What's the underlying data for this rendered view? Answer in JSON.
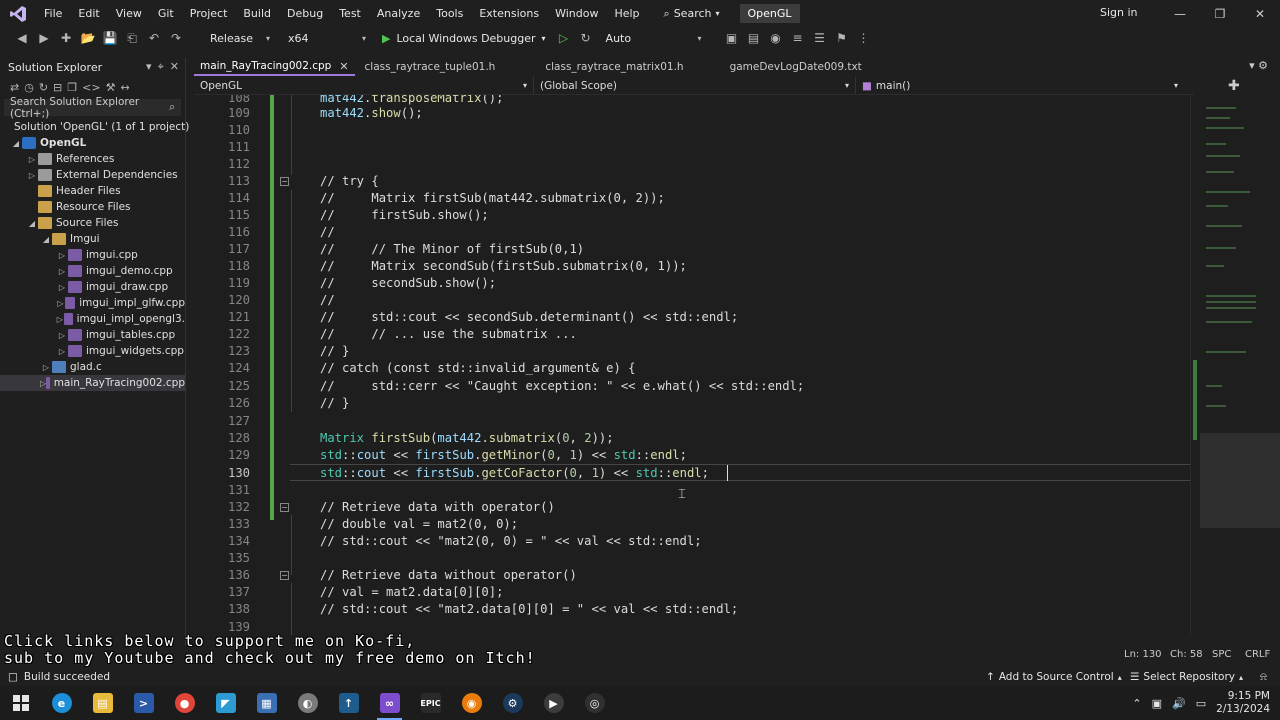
{
  "menubar": {
    "items": [
      "File",
      "Edit",
      "View",
      "Git",
      "Project",
      "Build",
      "Debug",
      "Test",
      "Analyze",
      "Tools",
      "Extensions",
      "Window",
      "Help"
    ],
    "search_label": "Search",
    "solution_name": "OpenGL",
    "sign_in": "Sign in"
  },
  "toolbar": {
    "configuration": "Release",
    "platform": "x64",
    "debugger": "Local Windows Debugger",
    "target": "Auto"
  },
  "solution_explorer": {
    "title": "Solution Explorer",
    "search_placeholder": "Search Solution Explorer (Ctrl+;)",
    "tree": [
      {
        "label": "Solution 'OpenGL' (1 of 1 project)",
        "icon": "solution-icon"
      },
      {
        "label": "OpenGL",
        "icon": "project-icon"
      },
      {
        "label": "References",
        "icon": "references-icon"
      },
      {
        "label": "External Dependencies",
        "icon": "external-deps-icon"
      },
      {
        "label": "Header Files",
        "icon": "folder-icon"
      },
      {
        "label": "Resource Files",
        "icon": "folder-icon"
      },
      {
        "label": "Source Files",
        "icon": "folder-icon"
      },
      {
        "label": "Imgui",
        "icon": "folder-icon"
      },
      {
        "label": "imgui.cpp",
        "icon": "cpp-file-icon"
      },
      {
        "label": "imgui_demo.cpp",
        "icon": "cpp-file-icon"
      },
      {
        "label": "imgui_draw.cpp",
        "icon": "cpp-file-icon"
      },
      {
        "label": "imgui_impl_glfw.cpp",
        "icon": "cpp-file-icon"
      },
      {
        "label": "imgui_impl_opengl3.",
        "icon": "cpp-file-icon"
      },
      {
        "label": "imgui_tables.cpp",
        "icon": "cpp-file-icon"
      },
      {
        "label": "imgui_widgets.cpp",
        "icon": "cpp-file-icon"
      },
      {
        "label": "glad.c",
        "icon": "c-file-icon"
      },
      {
        "label": "main_RayTracing002.cpp",
        "icon": "cpp-file-icon"
      }
    ]
  },
  "tabs": [
    {
      "label": "main_RayTracing002.cpp",
      "active": true
    },
    {
      "label": "class_raytrace_tuple01.h",
      "active": false
    },
    {
      "label": "class_raytrace_matrix01.h",
      "active": false
    },
    {
      "label": "gameDevLogDate009.txt",
      "active": false
    }
  ],
  "navbar": {
    "project": "OpenGL",
    "scope": "(Global Scope)",
    "member": "main()"
  },
  "code": {
    "current_line": "130",
    "lines": [
      {
        "n": "108",
        "text": "mat442.transposeMatrix();"
      },
      {
        "n": "109",
        "text": "mat442.show();"
      },
      {
        "n": "110",
        "text": ""
      },
      {
        "n": "111",
        "text": ""
      },
      {
        "n": "112",
        "text": ""
      },
      {
        "n": "113",
        "text": "// try {"
      },
      {
        "n": "114",
        "text": "//     Matrix firstSub(mat442.submatrix(0, 2));"
      },
      {
        "n": "115",
        "text": "//     firstSub.show();"
      },
      {
        "n": "116",
        "text": "//"
      },
      {
        "n": "117",
        "text": "//     // The Minor of firstSub(0,1)"
      },
      {
        "n": "118",
        "text": "//     Matrix secondSub(firstSub.submatrix(0, 1));"
      },
      {
        "n": "119",
        "text": "//     secondSub.show();"
      },
      {
        "n": "120",
        "text": "//"
      },
      {
        "n": "121",
        "text": "//     std::cout << secondSub.determinant() << std::endl;"
      },
      {
        "n": "122",
        "text": "//     // ... use the submatrix ..."
      },
      {
        "n": "123",
        "text": "// }"
      },
      {
        "n": "124",
        "text": "// catch (const std::invalid_argument& e) {"
      },
      {
        "n": "125",
        "text": "//     std::cerr << \"Caught exception: \" << e.what() << std::endl;"
      },
      {
        "n": "126",
        "text": "// }"
      },
      {
        "n": "127",
        "text": ""
      },
      {
        "n": "128",
        "text": "Matrix firstSub(mat442.submatrix(0, 2));"
      },
      {
        "n": "129",
        "text": "std::cout << firstSub.getMinor(0, 1) << std::endl;"
      },
      {
        "n": "130",
        "text": "std::cout << firstSub.getCoFactor(0, 1) << std::endl;"
      },
      {
        "n": "131",
        "text": ""
      },
      {
        "n": "132",
        "text": "// Retrieve data with operator()"
      },
      {
        "n": "133",
        "text": "// double val = mat2(0, 0);"
      },
      {
        "n": "134",
        "text": "// std::cout << \"mat2(0, 0) = \" << val << std::endl;"
      },
      {
        "n": "135",
        "text": ""
      },
      {
        "n": "136",
        "text": "// Retrieve data without operator()"
      },
      {
        "n": "137",
        "text": "// val = mat2.data[0][0];"
      },
      {
        "n": "138",
        "text": "// std::cout << \"mat2.data[0][0] = \" << val << std::endl;"
      },
      {
        "n": "139",
        "text": ""
      }
    ]
  },
  "editor_status": {
    "line": "Ln: 130",
    "col": "Ch: 58",
    "ins": "SPC",
    "eol": "CRLF"
  },
  "overlay": {
    "line1": "Click links below to support me on Ko-fi,",
    "line2": "sub to my Youtube and check out my free demo on Itch!"
  },
  "status_bar": {
    "build": "Build succeeded",
    "source_control": "Add to Source Control",
    "repository": "Select Repository"
  },
  "taskbar": {
    "time": "9:15 PM",
    "date": "2/13/2024",
    "icons": [
      "windows-start-icon",
      "edge-icon",
      "file-explorer-icon",
      "powershell-icon",
      "chrome-icon",
      "tool-icon",
      "calculator-icon",
      "app-icon",
      "app-icon",
      "visual-studio-icon",
      "epic-games-icon",
      "blender-icon",
      "steam-icon",
      "media-player-icon",
      "obs-icon"
    ]
  },
  "colors": {
    "accent": "#9e7adf",
    "comment": "#57a64a",
    "type": "#4ec9b0",
    "function": "#dcdcaa"
  }
}
